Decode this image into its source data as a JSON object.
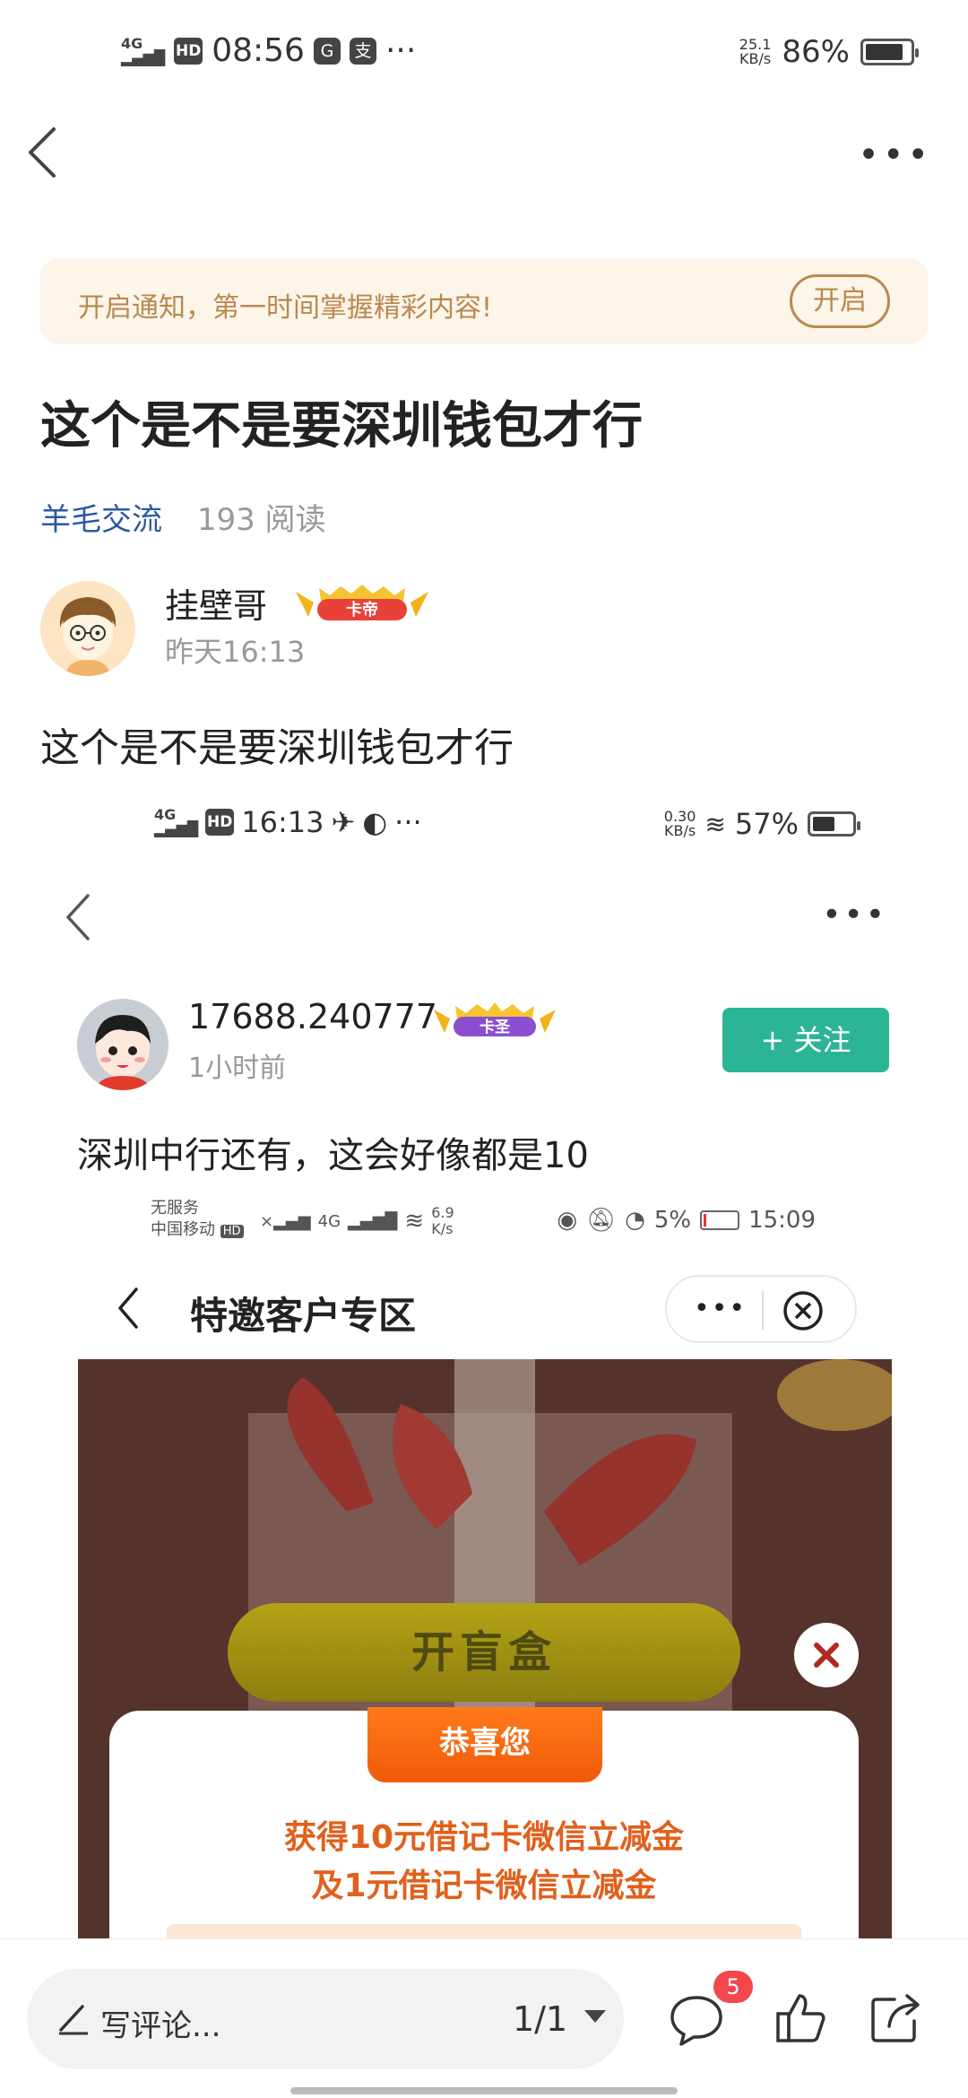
{
  "status_bar": {
    "network": "4G",
    "hd": "HD",
    "time": "08:56",
    "app_icon_1": "G",
    "app_icon_2": "支",
    "more": "···",
    "speed_value": "25.1",
    "speed_unit": "KB/s",
    "battery_pct": "86%",
    "battery_level": 0.86
  },
  "nav": {
    "back_icon": "chevron-left-icon",
    "more_icon": "more-horizontal-icon",
    "more": "•••"
  },
  "banner": {
    "text": "开启通知，第一时间掌握精彩内容!",
    "button": "开启"
  },
  "post": {
    "title": "这个是不是要深圳钱包才行",
    "category": "羊毛交流",
    "reads": "193 阅读",
    "author": "挂壁哥",
    "author_badge": "卡帝",
    "time": "昨天16:13",
    "body": "这个是不是要深圳钱包才行"
  },
  "embedded_1": {
    "status_network": "4G",
    "status_hd": "HD",
    "status_time": "16:13",
    "status_more": "···",
    "status_speed_value": "0.30",
    "status_speed_unit": "KB/s",
    "status_battery": "57%",
    "battery_level": 0.57,
    "more": "•••",
    "user": "17688.240777",
    "user_badge": "卡圣",
    "time": "1小时前",
    "follow": "+ 关注",
    "text": "深圳中行还有，这会好像都是10"
  },
  "embedded_2": {
    "status_no_service": "无服务",
    "status_carrier": "中国移动",
    "status_carrier_hd": "HD",
    "status_network": "4G",
    "status_speed_value": "6.9",
    "status_speed_unit": "K/s",
    "status_battery": "5%",
    "status_time": "15:09",
    "title": "特邀客户专区",
    "pill_more": "•••",
    "open_button": "开盲盒",
    "card_header": "恭喜您",
    "line1": "获得10元借记卡微信立减金",
    "line2": "及1元借记卡微信立减金"
  },
  "bottom_bar": {
    "comment_placeholder": "写评论...",
    "page_indicator": "1/1",
    "comment_count": "5",
    "icons": [
      "pencil-icon",
      "comment-icon",
      "thumbs-up-icon",
      "share-icon"
    ]
  },
  "colors": {
    "banner_bg": "#fdf4ea",
    "banner_text": "#b8894e",
    "category": "#2a5a9e",
    "follow_button": "#2bb594",
    "badge_red": "#f2474d",
    "card_orange": "#e0601c"
  }
}
